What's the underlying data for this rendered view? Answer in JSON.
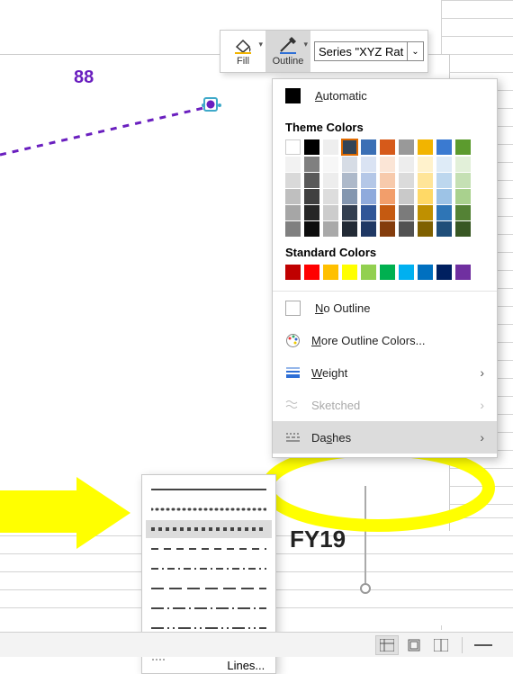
{
  "toolbar": {
    "fill_label": "Fill",
    "outline_label": "Outline",
    "series_value": "Series \"XYZ Rat"
  },
  "chart_data": {
    "type": "line",
    "series": [
      {
        "name": "XYZ Rat",
        "values": [
          88
        ],
        "style": "dashed",
        "color": "#6a1fbf"
      }
    ],
    "categories": [
      "FY19"
    ],
    "title": "",
    "xlabel": "",
    "ylabel": ""
  },
  "chart_ui": {
    "data_label": "88",
    "axis_category_label": "FY19"
  },
  "outline_menu": {
    "automatic": "Automatic",
    "theme_header": "Theme Colors",
    "theme_row": [
      "#ffffff",
      "#000000",
      "#eeeeee",
      "#334457",
      "#3b6fb5",
      "#d65a1a",
      "#999999",
      "#f2b400",
      "#3a7ad1",
      "#5c9b2e"
    ],
    "theme_tints": [
      [
        "#f2f2f2",
        "#d9d9d9",
        "#bfbfbf",
        "#a6a6a6",
        "#808080"
      ],
      [
        "#808080",
        "#595959",
        "#404040",
        "#262626",
        "#0d0d0d"
      ],
      [
        "#f7f7f7",
        "#ededed",
        "#dddddd",
        "#cccccc",
        "#a9a9a9"
      ],
      [
        "#d6dce5",
        "#adb9ca",
        "#8497b0",
        "#333f50",
        "#222a35"
      ],
      [
        "#dae3f3",
        "#b4c7e7",
        "#8faadc",
        "#2f5597",
        "#1f3864"
      ],
      [
        "#fbe5d6",
        "#f7caac",
        "#f29e6b",
        "#c55a11",
        "#843c0c"
      ],
      [
        "#ededed",
        "#dbdbdb",
        "#c9c9c9",
        "#7b7b7b",
        "#525252"
      ],
      [
        "#fff2cc",
        "#ffe599",
        "#ffd966",
        "#bf9000",
        "#7f6000"
      ],
      [
        "#deebf7",
        "#bdd7ee",
        "#9dc3e6",
        "#2e75b6",
        "#1f4e79"
      ],
      [
        "#e2f0d9",
        "#c5e0b4",
        "#a9d18e",
        "#548235",
        "#385723"
      ]
    ],
    "standard_header": "Standard Colors",
    "standard_row": [
      "#c00000",
      "#ff0000",
      "#ffc000",
      "#ffff00",
      "#92d050",
      "#00b050",
      "#00b0f0",
      "#0070c0",
      "#002060",
      "#7030a0"
    ],
    "no_outline": "No Outline",
    "more_colors": "More Outline Colors...",
    "weight": "Weight",
    "sketched": "Sketched",
    "dashes": "Dashes"
  },
  "dashes_flyout": {
    "more_lines": "More Lines..."
  }
}
